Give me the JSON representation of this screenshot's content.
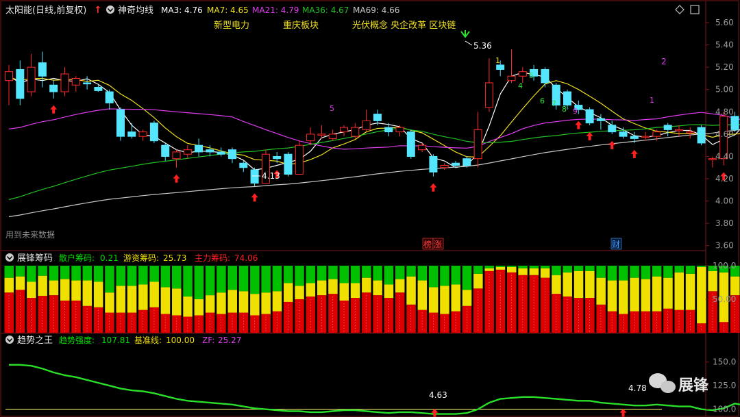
{
  "colors": {
    "bg": "#000000",
    "up": "#ff2a2a",
    "down": "#54e6ff",
    "ma3": "#ffffff",
    "ma7": "#f0e020",
    "ma21": "#e03cf0",
    "ma36": "#22c022",
    "ma69": "#c8c8c8",
    "text": "#e6e6e6",
    "axis": "#9a9a9a",
    "sep": "#7a1a1a",
    "panel_red": "#dd0000",
    "panel_yellow": "#f0e000",
    "panel_green": "#00c000",
    "trend_line": "#28e028",
    "base_line": "#d8d860"
  },
  "price_panel": {
    "stock_name": "太阳能(日线,前复权)",
    "indicator_name": "神奇均线",
    "ma_legend": [
      {
        "label": "MA3: 4.76",
        "color": "#ffffff"
      },
      {
        "label": "MA7: 4.65",
        "color": "#f0e020"
      },
      {
        "label": "MA21: 4.79",
        "color": "#e03cf0"
      },
      {
        "label": "MA36: 4.67",
        "color": "#22c022"
      },
      {
        "label": "MA69: 4.66",
        "color": "#c8c8c8"
      }
    ],
    "concepts": [
      "新型电力",
      "重庆板块",
      "光伏概念 央企改革 区块链"
    ],
    "bottom_left_note": "用到未来数据",
    "markers": [
      {
        "label": "榜",
        "color": "#ff4040"
      },
      {
        "label": "涨",
        "color": "#ff4040"
      },
      {
        "label": "财",
        "color": "#4aa0ff"
      }
    ],
    "high_label": "5.36",
    "low_label": "4.13",
    "wave_numbers": [
      "5",
      "1",
      "5",
      "4",
      "6",
      "7",
      "8",
      "9",
      "1",
      "2"
    ]
  },
  "chip_panel": {
    "title": "展锋筹码",
    "items": [
      {
        "label": "散户筹码:",
        "value": "0.21",
        "color": "#00e000"
      },
      {
        "label": "游资筹码:",
        "value": "25.73",
        "color": "#f0e000"
      },
      {
        "label": "主力筹码:",
        "value": "74.06",
        "color": "#ff2020"
      }
    ]
  },
  "trend_panel": {
    "title": "趋势之王",
    "items": [
      {
        "label": "趋势强度:",
        "value": "107.81",
        "color": "#00e000"
      },
      {
        "label": "基准线:",
        "value": "100.00",
        "color": "#f0e000"
      },
      {
        "label": "ZF:",
        "value": "25.27",
        "color": "#e03cf0"
      }
    ],
    "annotations": [
      "4.63",
      "4.78"
    ]
  },
  "watermark": "展锋",
  "chart_data": [
    {
      "type": "candlestick",
      "y_ticks": [
        "5.60",
        "5.40",
        "5.20",
        "5.00",
        "4.80",
        "4.60",
        "4.40",
        "4.20",
        "4.00",
        "3.80",
        "3.60"
      ],
      "ylim": [
        3.58,
        5.68
      ],
      "candles": [
        [
          5.08,
          5.16,
          5.22,
          4.86
        ],
        [
          5.18,
          4.92,
          5.26,
          4.86
        ],
        [
          4.98,
          5.2,
          5.32,
          4.94
        ],
        [
          5.24,
          5.12,
          5.34,
          5.02
        ],
        [
          5.04,
          4.98,
          5.08,
          4.92
        ],
        [
          4.98,
          5.14,
          5.2,
          4.94
        ],
        [
          5.04,
          5.1,
          5.12,
          4.98
        ],
        [
          5.06,
          5.05,
          5.12,
          5.0
        ],
        [
          5.02,
          4.99,
          5.04,
          4.98
        ],
        [
          4.98,
          4.88,
          5.0,
          4.82
        ],
        [
          4.82,
          4.58,
          4.84,
          4.54
        ],
        [
          4.62,
          4.58,
          4.7,
          4.56
        ],
        [
          4.58,
          4.62,
          4.64,
          4.54
        ],
        [
          4.7,
          4.54,
          4.72,
          4.52
        ],
        [
          4.5,
          4.4,
          4.52,
          4.36
        ],
        [
          4.38,
          4.44,
          4.46,
          4.3
        ],
        [
          4.42,
          4.46,
          4.5,
          4.38
        ],
        [
          4.5,
          4.44,
          4.56,
          4.4
        ],
        [
          4.46,
          4.44,
          4.5,
          4.4
        ],
        [
          4.44,
          4.42,
          4.48,
          4.4
        ],
        [
          4.46,
          4.38,
          4.48,
          4.34
        ],
        [
          4.34,
          4.3,
          4.36,
          4.26
        ],
        [
          4.28,
          4.16,
          4.3,
          4.13
        ],
        [
          4.16,
          4.42,
          4.46,
          4.16
        ],
        [
          4.4,
          4.38,
          4.44,
          4.34
        ],
        [
          4.42,
          4.24,
          4.44,
          4.22
        ],
        [
          4.24,
          4.5,
          4.54,
          4.24
        ],
        [
          4.54,
          4.6,
          4.66,
          4.5
        ],
        [
          4.6,
          4.6,
          4.68,
          4.56
        ],
        [
          4.56,
          4.6,
          4.64,
          4.54
        ],
        [
          4.62,
          4.66,
          4.68,
          4.58
        ],
        [
          4.58,
          4.66,
          4.7,
          4.56
        ],
        [
          4.64,
          4.72,
          4.82,
          4.62
        ],
        [
          4.78,
          4.72,
          4.82,
          4.68
        ],
        [
          4.66,
          4.62,
          4.7,
          4.58
        ],
        [
          4.62,
          4.66,
          4.68,
          4.58
        ],
        [
          4.62,
          4.4,
          4.64,
          4.38
        ],
        [
          4.46,
          4.5,
          4.52,
          4.44
        ],
        [
          4.4,
          4.26,
          4.42,
          4.22
        ],
        [
          4.3,
          4.32,
          4.34,
          4.28
        ],
        [
          4.34,
          4.32,
          4.36,
          4.3
        ],
        [
          4.38,
          4.32,
          4.4,
          4.3
        ],
        [
          4.38,
          4.64,
          4.8,
          4.3
        ],
        [
          4.84,
          5.06,
          5.28,
          4.8
        ],
        [
          5.22,
          5.18,
          5.26,
          5.12
        ],
        [
          5.08,
          5.12,
          5.36,
          5.06
        ],
        [
          5.12,
          5.16,
          5.2,
          5.06
        ],
        [
          5.18,
          5.12,
          5.22,
          5.08
        ],
        [
          5.18,
          5.06,
          5.2,
          5.02
        ],
        [
          5.04,
          4.86,
          5.06,
          4.82
        ],
        [
          4.98,
          4.86,
          5.0,
          4.82
        ],
        [
          4.86,
          4.82,
          4.9,
          4.78
        ],
        [
          4.82,
          4.7,
          4.84,
          4.68
        ],
        [
          4.74,
          4.72,
          4.78,
          4.64
        ],
        [
          4.68,
          4.62,
          4.72,
          4.6
        ],
        [
          4.62,
          4.58,
          4.66,
          4.56
        ],
        [
          4.58,
          4.56,
          4.62,
          4.52
        ],
        [
          4.58,
          4.58,
          4.62,
          4.54
        ],
        [
          4.58,
          4.62,
          4.64,
          4.54
        ],
        [
          4.68,
          4.64,
          4.7,
          4.58
        ],
        [
          4.64,
          4.64,
          4.68,
          4.58
        ],
        [
          4.62,
          4.62,
          4.66,
          4.56
        ],
        [
          4.66,
          4.52,
          4.68,
          4.5
        ],
        [
          4.38,
          4.38,
          4.4,
          4.3
        ],
        [
          4.38,
          4.76,
          4.8,
          4.32
        ],
        [
          4.76,
          4.64,
          4.8,
          4.62
        ],
        [
          4.68,
          4.7,
          4.82,
          4.66
        ],
        [
          4.64,
          4.8,
          4.86,
          4.62
        ],
        [
          4.74,
          4.94,
          5.06,
          4.7
        ]
      ]
    },
    {
      "type": "stacked_bar",
      "series_names": [
        "散户筹码",
        "游资筹码",
        "主力筹码"
      ],
      "y_ticks": [
        "100.0",
        "50.00"
      ],
      "ylim": [
        0,
        100
      ],
      "red": [
        60,
        64,
        52,
        55,
        56,
        48,
        48,
        40,
        38,
        30,
        30,
        30,
        34,
        38,
        28,
        26,
        24,
        26,
        30,
        28,
        30,
        30,
        26,
        28,
        32,
        46,
        50,
        54,
        56,
        58,
        48,
        52,
        60,
        56,
        52,
        60,
        42,
        34,
        30,
        28,
        32,
        40,
        66,
        92,
        94,
        90,
        86,
        86,
        82,
        58,
        54,
        52,
        52,
        42,
        32,
        28,
        32,
        32,
        32,
        36,
        34,
        34,
        14,
        62,
        16,
        56,
        48,
        42,
        74
      ],
      "yellow": [
        22,
        20,
        24,
        30,
        22,
        32,
        30,
        38,
        38,
        30,
        40,
        40,
        38,
        38,
        40,
        40,
        30,
        24,
        26,
        32,
        34,
        32,
        32,
        32,
        30,
        28,
        20,
        20,
        22,
        22,
        26,
        22,
        22,
        22,
        20,
        20,
        42,
        44,
        38,
        42,
        40,
        24,
        22,
        4,
        4,
        8,
        10,
        10,
        14,
        28,
        36,
        40,
        40,
        40,
        46,
        50,
        50,
        48,
        52,
        46,
        56,
        54,
        84,
        30,
        74,
        28,
        38,
        40,
        26
      ]
    },
    {
      "type": "line",
      "y_ticks": [
        "150.0",
        "125.0",
        "100.0"
      ],
      "ylim": [
        94,
        165
      ],
      "series": [
        {
          "name": "趋势强度",
          "values": [
            147,
            147,
            146,
            143,
            139,
            136,
            134,
            131,
            128,
            125,
            122,
            120,
            119,
            117,
            114,
            111,
            109,
            108,
            107,
            106,
            105,
            103,
            101,
            100,
            99,
            98,
            98,
            97,
            97,
            98,
            99,
            99,
            98,
            97,
            96,
            97,
            97,
            96,
            95,
            95,
            95,
            96,
            100,
            107,
            111,
            112,
            113,
            113,
            112,
            111,
            110,
            109,
            109,
            107,
            106,
            105,
            104,
            104,
            105,
            104,
            103,
            103,
            100,
            99,
            101,
            106,
            104,
            104,
            108
          ]
        },
        {
          "name": "基准线",
          "values": [
            100,
            100
          ]
        }
      ]
    }
  ]
}
